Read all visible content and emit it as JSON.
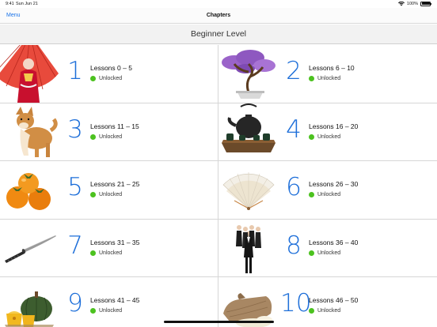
{
  "status_bar": {
    "time": "9:41",
    "date": "Sun Jun 21",
    "battery": "100%",
    "battery_level": 1.0
  },
  "nav": {
    "menu_label": "Menu",
    "title": "Chapters"
  },
  "section": {
    "title": "Beginner Level"
  },
  "colors": {
    "accent": "#1e6fd9",
    "unlocked": "#4cc21f"
  },
  "chapters": [
    {
      "number": "1",
      "lessons": "Lessons 0 – 5",
      "status": "Unlocked",
      "image": "geisha-umbrella"
    },
    {
      "number": "2",
      "lessons": "Lessons 6 – 10",
      "status": "Unlocked",
      "image": "bonsai-tree"
    },
    {
      "number": "3",
      "lessons": "Lessons 11 – 15",
      "status": "Unlocked",
      "image": "shiba-dog"
    },
    {
      "number": "4",
      "lessons": "Lessons 16 – 20",
      "status": "Unlocked",
      "image": "teapot-set"
    },
    {
      "number": "5",
      "lessons": "Lessons 21 – 25",
      "status": "Unlocked",
      "image": "persimmons"
    },
    {
      "number": "6",
      "lessons": "Lessons 26 – 30",
      "status": "Unlocked",
      "image": "paper-fan"
    },
    {
      "number": "7",
      "lessons": "Lessons 31 – 35",
      "status": "Unlocked",
      "image": "katana"
    },
    {
      "number": "8",
      "lessons": "Lessons 36 – 40",
      "status": "Unlocked",
      "image": "business-people"
    },
    {
      "number": "9",
      "lessons": "Lessons 41 – 45",
      "status": "Unlocked",
      "image": "pumpkin"
    },
    {
      "number": "10",
      "lessons": "Lessons 46 – 50",
      "status": "Unlocked",
      "image": "rice-sack"
    }
  ]
}
